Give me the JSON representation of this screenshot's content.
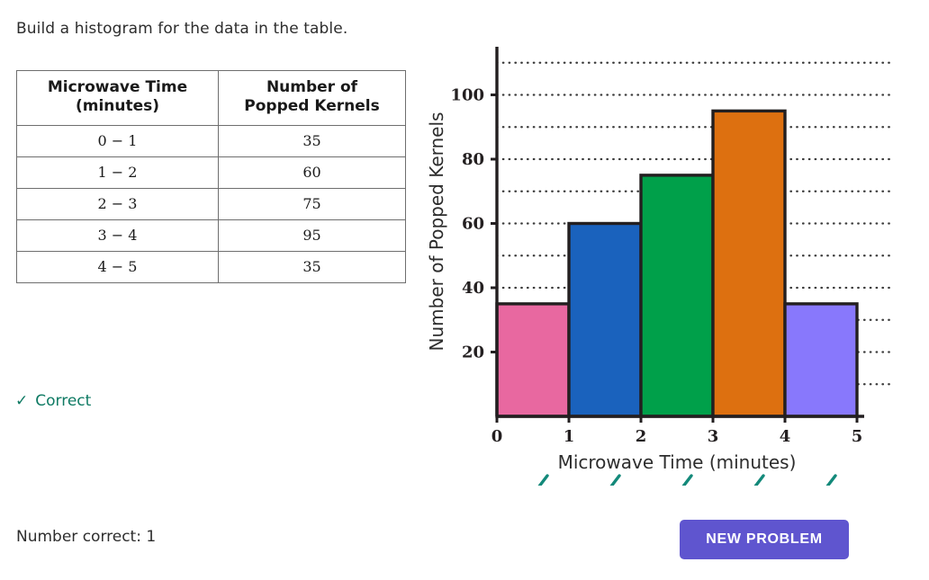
{
  "prompt": "Build a histogram for the data in the table.",
  "table": {
    "headers": [
      "Microwave Time\n(minutes)",
      "Number of\nPopped Kernels"
    ],
    "header_a_line1": "Microwave Time",
    "header_a_line2": "(minutes)",
    "header_b_line1": "Number of",
    "header_b_line2": "Popped Kernels",
    "rows": [
      {
        "interval": "0 − 1",
        "count": "35"
      },
      {
        "interval": "1 − 2",
        "count": "60"
      },
      {
        "interval": "2 − 3",
        "count": "75"
      },
      {
        "interval": "3 − 4",
        "count": "95"
      },
      {
        "interval": "4 − 5",
        "count": "35"
      }
    ]
  },
  "feedback": {
    "icon": "check-icon",
    "label": "Correct",
    "color": "#0e7a63"
  },
  "score": {
    "label": "Number correct: 1",
    "value": 1
  },
  "button": {
    "label": "NEW PROBLEM",
    "color": "#5f55cf"
  },
  "bar_checkmarks": {
    "count": 5,
    "color": "#13897a",
    "glyph": "check-icon"
  },
  "chart_data": {
    "type": "bar",
    "title": "",
    "xlabel": "Microwave Time (minutes)",
    "ylabel": "Number of Popped Kernels",
    "categories": [
      "0 − 1",
      "1 − 2",
      "2 − 3",
      "3 − 4",
      "4 − 5"
    ],
    "bin_edges": [
      0,
      1,
      2,
      3,
      4,
      5
    ],
    "values": [
      35,
      60,
      75,
      95,
      35
    ],
    "bar_colors": [
      "#e868a0",
      "#1a62bd",
      "#00a04a",
      "#dd7010",
      "#8878fc"
    ],
    "bar_edge_color": "#231f20",
    "xlim": [
      0,
      5.45
    ],
    "ylim": [
      0,
      115
    ],
    "xticks": [
      0,
      1,
      2,
      3,
      4,
      5
    ],
    "xtick_labels": [
      "0",
      "1",
      "2",
      "3",
      "4",
      "5"
    ],
    "yticks": [
      20,
      40,
      60,
      80,
      100
    ],
    "ytick_labels": [
      "20",
      "40",
      "60",
      "80",
      "100"
    ],
    "gridlines_y": [
      10,
      20,
      30,
      40,
      50,
      60,
      70,
      80,
      90,
      100,
      110
    ],
    "grid": "dotted-horizontal",
    "grid_color": "#3a3a3a",
    "legend": "none"
  }
}
